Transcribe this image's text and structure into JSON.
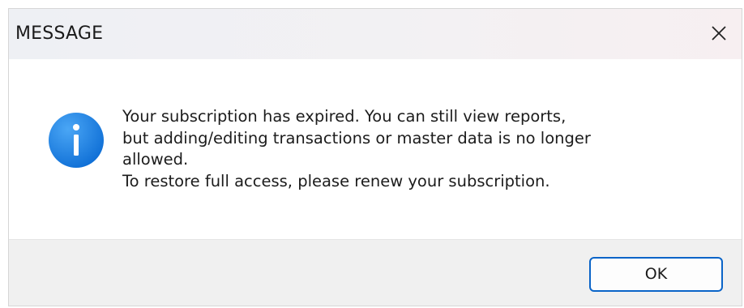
{
  "dialog": {
    "title": "MESSAGE",
    "close_icon": "close-icon",
    "info_icon": "info-icon",
    "message_lines": [
      "Your subscription has expired. You can still view reports,",
      "but adding/editing transactions or master data is no longer",
      "allowed.",
      "To restore full access, please renew your subscription."
    ],
    "ok_label": "OK"
  },
  "colors": {
    "accent": "#0a64c8",
    "info_blue": "#1d7fe0",
    "footer_bg": "#f0f0f0"
  }
}
